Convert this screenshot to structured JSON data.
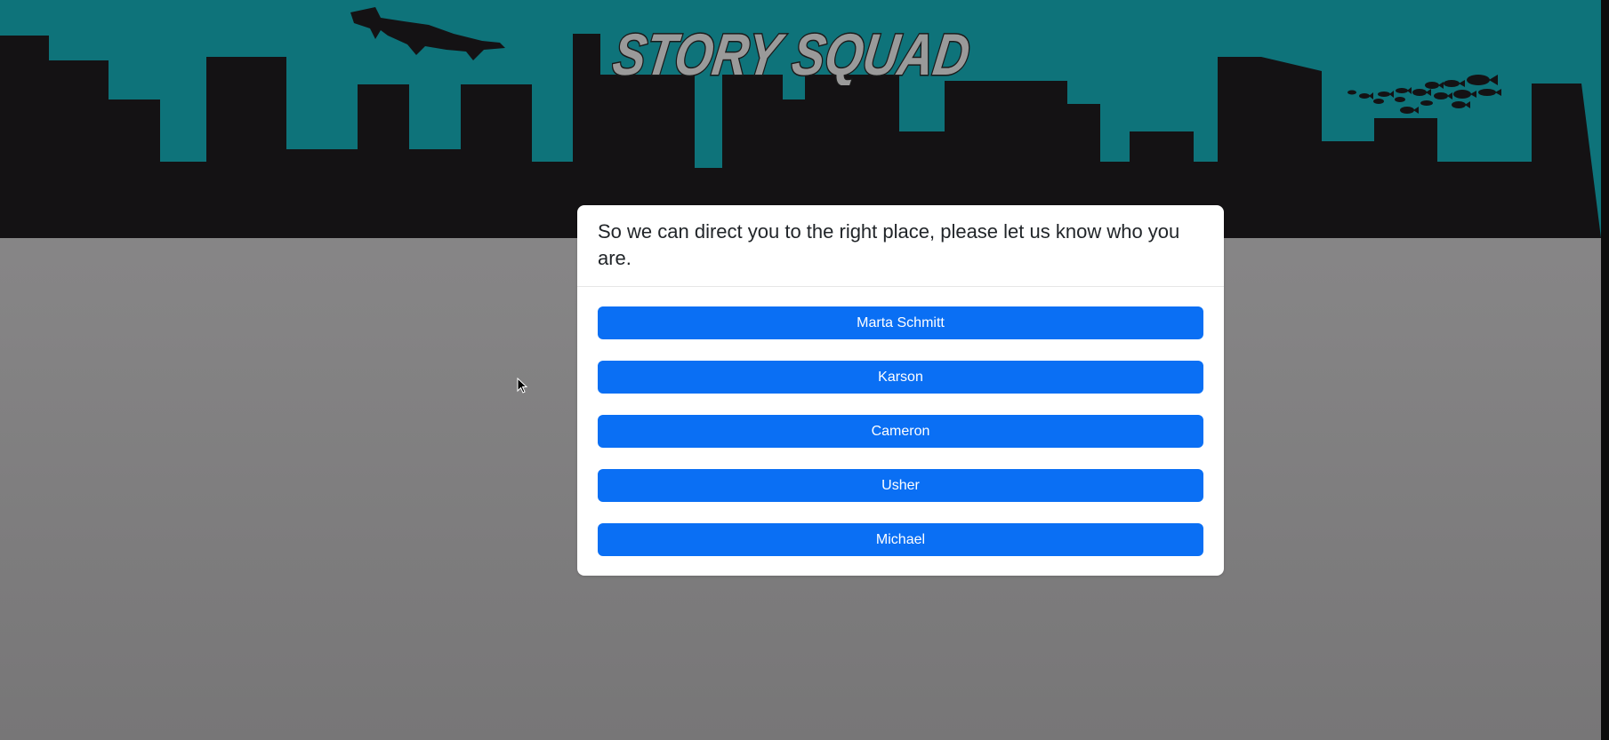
{
  "header": {
    "logo_text": "STORY SQUAD",
    "background_color": "#0e737a",
    "skyline_color": "#141214"
  },
  "modal": {
    "title": "So we can direct you to the right place, please let us know who you are.",
    "users": [
      {
        "label": "Marta Schmitt"
      },
      {
        "label": "Karson"
      },
      {
        "label": "Cameron"
      },
      {
        "label": "Usher"
      },
      {
        "label": "Michael"
      }
    ],
    "button_color": "#0a6ff4"
  },
  "icons": {
    "cursor": "mouse-pointer-icon",
    "shark": "hammerhead-shark-icon",
    "fish": "fish-school-icon"
  }
}
